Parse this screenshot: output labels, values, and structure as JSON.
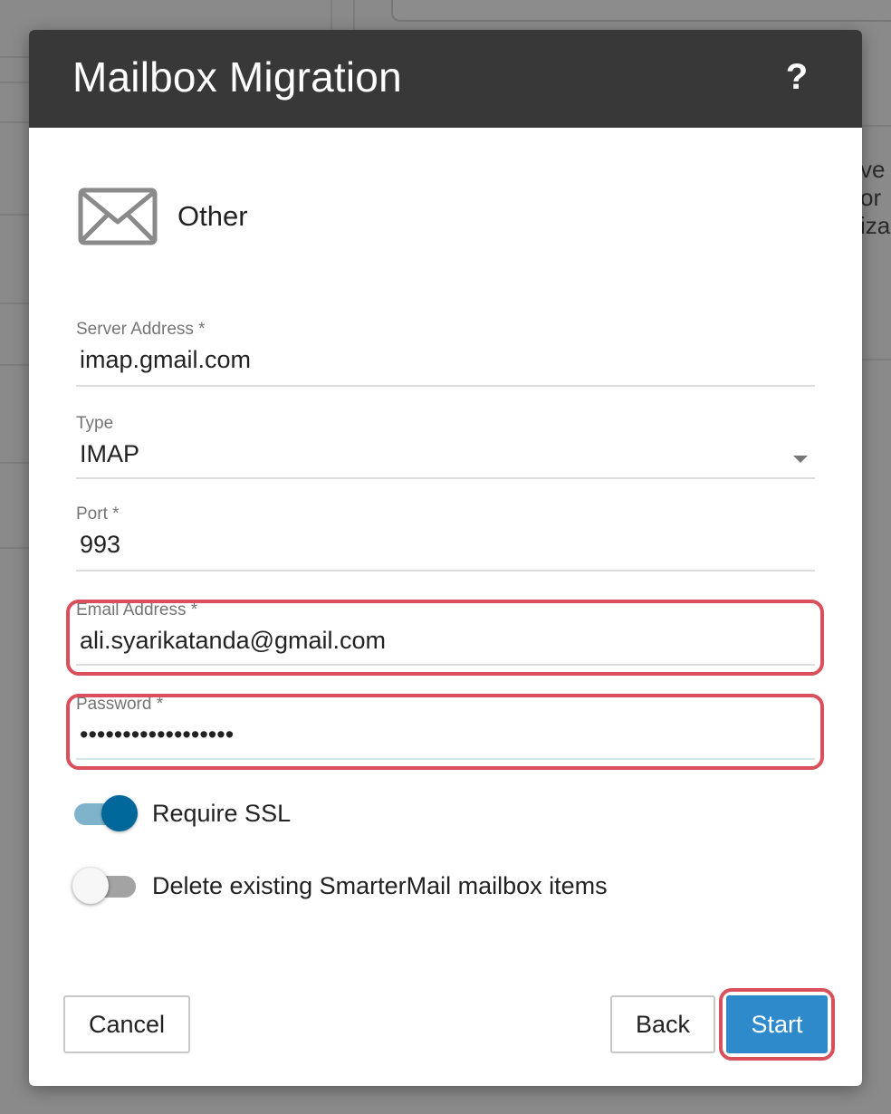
{
  "background": {
    "snippets": [
      "ve",
      "or",
      "iza"
    ]
  },
  "dialog": {
    "title": "Mailbox Migration",
    "help_label": "?",
    "provider": {
      "icon": "envelope-icon",
      "label": "Other"
    },
    "fields": {
      "server_address": {
        "label": "Server Address *",
        "value": "imap.gmail.com"
      },
      "type": {
        "label": "Type",
        "value": "IMAP"
      },
      "port": {
        "label": "Port *",
        "value": "993"
      },
      "email_address": {
        "label": "Email Address *",
        "value": "ali.syarikatanda@gmail.com"
      },
      "password": {
        "label": "Password *",
        "value": "••••••••••••••••••"
      }
    },
    "toggles": {
      "require_ssl": {
        "label": "Require SSL",
        "enabled": true
      },
      "delete_existing": {
        "label": "Delete existing SmarterMail mailbox items",
        "enabled": false
      }
    },
    "buttons": {
      "cancel": "Cancel",
      "back": "Back",
      "start": "Start"
    },
    "colors": {
      "header_bg": "#383838",
      "primary": "#2f8acb",
      "toggle_on": "#00679a",
      "highlight": "#d9505c"
    }
  }
}
